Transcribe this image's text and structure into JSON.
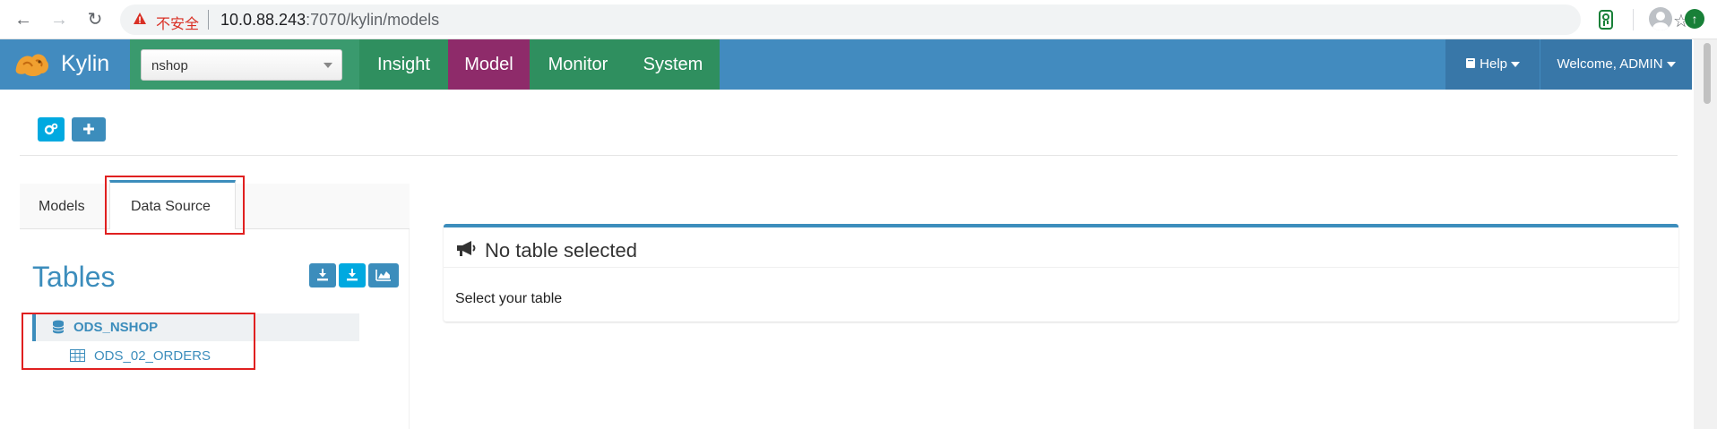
{
  "browser": {
    "insecure_label": "不安全",
    "url_host": "10.0.88.243",
    "url_path": ":7070/kylin/models"
  },
  "navbar": {
    "brand": "Kylin",
    "project": "nshop",
    "tabs": [
      "Insight",
      "Model",
      "Monitor",
      "System"
    ],
    "active_tab": "Model",
    "help_label": "Help",
    "welcome_label": "Welcome, ADMIN"
  },
  "left": {
    "tabs": {
      "models": "Models",
      "data_source": "Data Source"
    },
    "active_tab": "Data Source",
    "tables_title": "Tables",
    "database": "ODS_NSHOP",
    "tables": [
      "ODS_02_ORDERS"
    ]
  },
  "right": {
    "title": "No table selected",
    "message": "Select your table"
  },
  "colors": {
    "navbar": "#428bbf",
    "tab_green": "#2f8f5f",
    "tab_active": "#8e2b6a",
    "accent": "#3c8dbc",
    "highlight_box": "#e02020"
  }
}
